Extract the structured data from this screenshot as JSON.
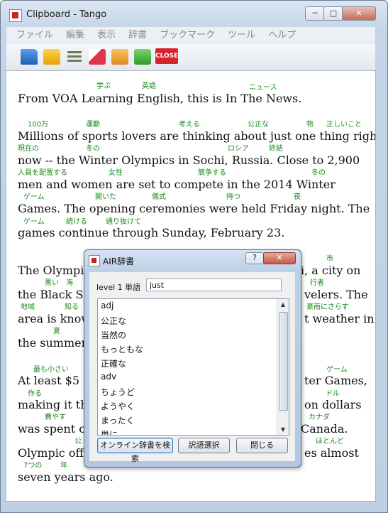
{
  "window": {
    "title": "Clipboard - Tango",
    "controls": {
      "minimize": "─",
      "maximize": "□",
      "close": "✕"
    }
  },
  "menu": [
    "ファイル",
    "編集",
    "表示",
    "辞書",
    "ブックマーク",
    "ツール",
    "ヘルプ"
  ],
  "toolbar": {
    "close_label": "CLOSE"
  },
  "text_lines": [
    "From VOA Learning English, this is In The News.",
    "Millions of sports lovers are thinking about  just  one thing  right",
    "now -- the Winter Olympics in Sochi, Russia. Close to 2,900",
    "   men      and women are set to compete in the 2014 Winter",
    "Games. The opening ceremonies were held Friday night. The",
    "games continue through Sunday, February 23.",
    "The Olympic",
    "the Black Se",
    "area is know",
    "the summer.",
    "At   least   $5",
    "making it the",
    "was spent or",
    "Olympic offi",
    "seven years ago.",
    "i, a city on",
    "velers. The",
    "t weather in",
    "ter Games,",
    "on dollars",
    "Canada.",
    "es almost"
  ],
  "annotations": [
    "学ぶ",
    "英語",
    "ニュース",
    "100万",
    "運動",
    "考える",
    "公正な",
    "物",
    "正しいこと",
    "現在の",
    "冬の",
    "ロシア",
    "終結",
    "人員を配置する",
    "女性",
    "競争する",
    "冬の",
    "ゲーム",
    "開いた",
    "儀式",
    "持つ",
    "夜",
    "ゲーム",
    "続ける",
    "通り抜けて",
    "市",
    "黒い",
    "海",
    "行者",
    "地域",
    "知る",
    "豪雨にさらす",
    "夏",
    "最も小さい",
    "ゲーム",
    "作る",
    "ドル",
    "費やす",
    "カナダ",
    "公",
    "ほとんど",
    "7つの",
    "年"
  ],
  "dialog": {
    "title": "AIR辞書",
    "help": "?",
    "close": "✕",
    "level_label": "level 1 単語",
    "word": "just",
    "definitions": [
      "adj",
      "公正な",
      "当然の",
      "もっともな",
      "正確な",
      "adv",
      "ちょうど",
      "ようやく",
      "まったく",
      "単に"
    ],
    "scroll_up": "▲",
    "scroll_down": "▼",
    "buttons": {
      "search": "オンライン辞書を検索",
      "select": "訳語選択",
      "close": "閉じる"
    }
  }
}
